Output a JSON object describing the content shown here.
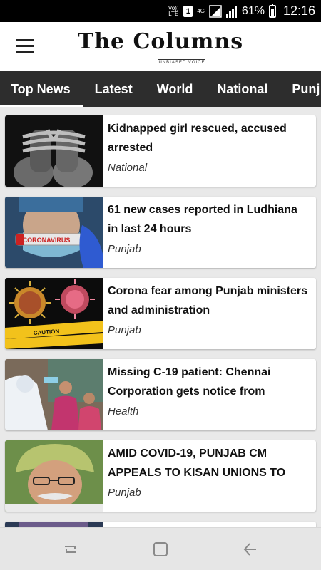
{
  "status_bar": {
    "volte": "Vo)) LTE",
    "sim": "1",
    "network": "4G",
    "battery_pct": "61%",
    "time": "12:16"
  },
  "header": {
    "title": "The Columns",
    "subtitle": "UNBIASED VOICE"
  },
  "tabs": [
    {
      "label": "Top News"
    },
    {
      "label": "Latest"
    },
    {
      "label": "World"
    },
    {
      "label": "National"
    },
    {
      "label": "Punj"
    }
  ],
  "articles": [
    {
      "title": "Kidnapped girl rescued, accused arrested",
      "category": "National"
    },
    {
      "title": "61 new cases reported in Ludhiana in last 24 hours",
      "category": "Punjab"
    },
    {
      "title": "Corona fear among Punjab ministers and administration",
      "category": "Punjab"
    },
    {
      "title": "Missing C-19 patient: Chennai Corporation gets notice from",
      "category": "Health"
    },
    {
      "title": "AMID COVID-19, PUNJAB CM APPEALS TO KISAN UNIONS TO",
      "category": "Punjab"
    }
  ],
  "thumb_text": {
    "vial": "CORONAVIRUS",
    "tape": "CAUTION"
  },
  "colors": {
    "tabbar_bg": "#2d2d2d",
    "feed_bg": "#e9e9e9",
    "status_bar_bg": "#000000"
  }
}
